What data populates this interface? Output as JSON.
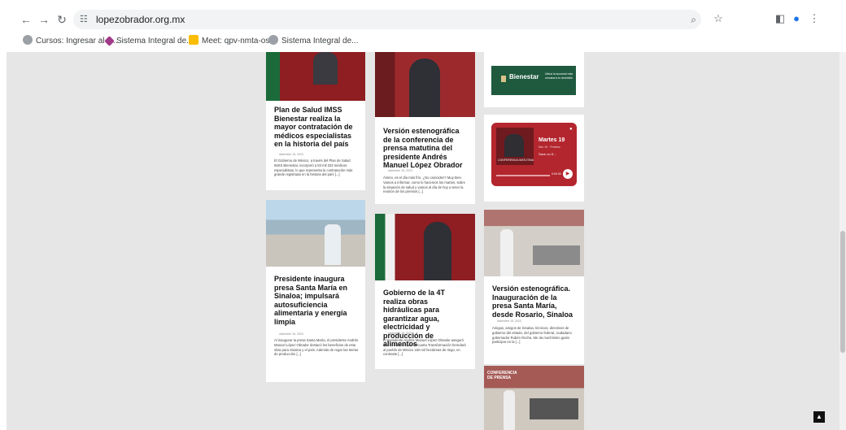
{
  "browser": {
    "url": "lopezobrador.org.mx",
    "icons": [
      "back-arrow-icon",
      "forward-arrow-icon",
      "reload-icon",
      "site-info-icon",
      "zoom-icon",
      "star-icon",
      "side-panel-icon",
      "profile-icon",
      "menu-kebab-icon"
    ]
  },
  "bookmarks": [
    {
      "label": "Cursos: Ingresar al s...",
      "icon": "globe-icon"
    },
    {
      "label": "Sistema Integral de...",
      "icon": "purple-diamond-icon"
    },
    {
      "label": "Meet: qpv-nmta-osh",
      "icon": "meet-icon"
    },
    {
      "label": "Sistema Integral de...",
      "icon": "globe-icon"
    }
  ],
  "cards": [
    {
      "title": "Plan de Salud IMSS Bienestar realiza la mayor contratación de médicos especialistas en la historia del país",
      "date": "diciembre 15, 2023",
      "excerpt": "El Gobierno de México, a través del Plan de Salud IMSS Bienestar, incorporó a 83 mil 323 médicos especialistas, lo que representa la contratación más grande registrada en la historia del país [...]"
    },
    {
      "title": "Versión estenográfica de la conferencia de prensa matutina del presidente Andrés Manuel López Obrador",
      "date": "diciembre 15, 2023",
      "excerpt": "Ánimo, es el día más frío. ¿No coinciden? Muy bien. Vamos a informar, como lo hacemos los martes, sobre la situación de salud y vamos al día de hoy a tener la reunión de los premios [...]"
    },
    {
      "title": "",
      "date": "",
      "excerpt": "",
      "banner": {
        "logo": "Bienestar",
        "text": "Ubica la sucursal más cercana a tu domicilio"
      }
    },
    {
      "title": "",
      "date": "",
      "excerpt": "",
      "podcast": {
        "title": "Martes 19",
        "subtitle": "Dec 19 · Preview",
        "save": "Save on S...",
        "time": "0:00:30",
        "art": "CONFERENCIA MATUTINA"
      }
    },
    {
      "title": "Presidente inaugura presa Santa María en Sinaloa; impulsará autosuficiencia alimentaria y energía limpia",
      "date": "diciembre 15, 2023",
      "excerpt": "Al inaugurar la presa Santa María, el presidente Andrés Manuel López Obrador destacó los beneficios de esta obra para Sinaloa y el país. Además de regar las tierras de producción [...]"
    },
    {
      "title": "Gobierno de la 4T realiza obras hidráulicas para garantizar agua, electricidad y producción de alimentos",
      "date": "diciembre 15, 2023",
      "excerpt": "El presidente Andrés Manuel López Obrador aseguró que el Gobierno de la Cuarta Transformación heredará al pueblo de México 150 mil hectáreas de riego, en contraste [...]"
    },
    {
      "title": "Versión estenográfica. Inauguración de la presa Santa María, desde Rosario, Sinaloa",
      "date": "diciembre 15, 2023",
      "excerpt": "Amigas, amigos de Sinaloa, técnicos, directivos de gobierno del estado, del gobierno federal, ciudadano gobernador Rubén Rocha. Me da muchísimo gusto participar en la [...]"
    },
    {
      "title": "",
      "date": "",
      "excerpt": "",
      "image_text": "CONFERENCIA DE PRENSA"
    }
  ],
  "colors": {
    "accent_red": "#c2292b",
    "bienestar_green": "#1f5a3f",
    "podcast_red": "#b3262e",
    "viewport_bg": "#e6e6e6"
  },
  "back_to_top": "▲"
}
